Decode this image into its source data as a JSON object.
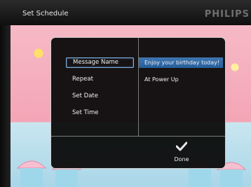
{
  "header": {
    "title": "Set Schedule",
    "brand": "PHILIPS"
  },
  "dialog": {
    "menu_items": [
      {
        "label": "Message Name"
      },
      {
        "label": "Repeat"
      },
      {
        "label": "Set Date"
      },
      {
        "label": "Set Time"
      }
    ],
    "values": [
      {
        "text": "Enjoy your birthday today!"
      },
      {
        "text": "At Power Up"
      }
    ],
    "done_label": "Done",
    "done_icon": "checkmark-icon"
  },
  "colors": {
    "highlight": "#2f6aa8",
    "selected_border": "#7fb0dc",
    "dialog_bg": "#080808"
  }
}
